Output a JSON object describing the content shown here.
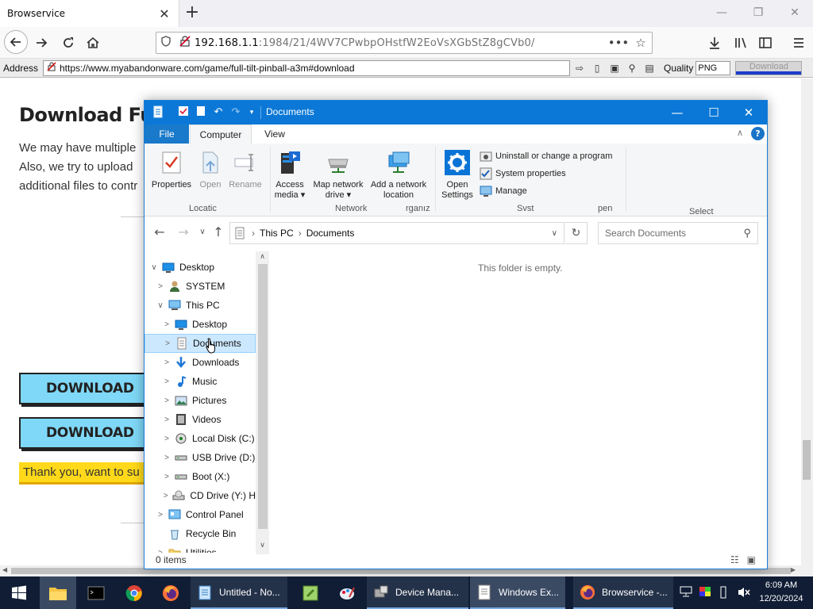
{
  "browser": {
    "tab_title": "Browservice",
    "tab_close": "✕",
    "new_tab": "+",
    "url_host": "192.168.1.1",
    "url_rest": ":1984/21/4WV7CPwbpOHstfW2EoVsXGbStZ8gCVb0/",
    "url_more": "•••",
    "window_controls": [
      "—",
      "❐",
      "✕"
    ]
  },
  "addressbar": {
    "label": "Address",
    "url": "https://www.myabandonware.com/game/full-tilt-pinball-a3m#download",
    "quality_label": "Quality",
    "quality_value": "PNG",
    "download_label": "Download"
  },
  "page": {
    "heading": "Download Full T",
    "para_lines": [
      "We may have multiple",
      "Also, we try to upload",
      "additional files to contr"
    ],
    "download_buttons": [
      "DOWNLOAD",
      "DOWNLOAD"
    ],
    "thanks_text": "Thank you, want to su"
  },
  "explorer": {
    "title": "Documents",
    "tabs": {
      "file": "File",
      "computer": "Computer",
      "view": "View"
    },
    "ribbon": {
      "properties": "Properties",
      "open": "Open",
      "rename": "Rename",
      "access_media": [
        "Access",
        "media ▾"
      ],
      "map_network": [
        "Map network",
        "drive ▾"
      ],
      "add_location": [
        "Add a network",
        "location"
      ],
      "open_settings": [
        "Open",
        "Settings"
      ],
      "uninstall": "Uninstall or change a program",
      "system_properties": "System properties",
      "manage": "Manage",
      "groups": [
        "Locatic",
        "Network",
        "rganız",
        "Svst",
        "pen",
        "Select"
      ]
    },
    "path": [
      "This PC",
      "Documents"
    ],
    "search_placeholder": "Search Documents",
    "tree": [
      {
        "label": "Desktop",
        "level": 0,
        "chev": "∨",
        "icon": "desktop"
      },
      {
        "label": "SYSTEM",
        "level": 1,
        "chev": ">",
        "icon": "user"
      },
      {
        "label": "This PC",
        "level": 1,
        "chev": "∨",
        "icon": "pc"
      },
      {
        "label": "Desktop",
        "level": 2,
        "chev": ">",
        "icon": "desktop"
      },
      {
        "label": "Documents",
        "level": 2,
        "chev": ">",
        "icon": "doc",
        "selected": true
      },
      {
        "label": "Downloads",
        "level": 2,
        "chev": ">",
        "icon": "download"
      },
      {
        "label": "Music",
        "level": 2,
        "chev": ">",
        "icon": "music"
      },
      {
        "label": "Pictures",
        "level": 2,
        "chev": ">",
        "icon": "pictures"
      },
      {
        "label": "Videos",
        "level": 2,
        "chev": ">",
        "icon": "videos"
      },
      {
        "label": "Local Disk (C:)",
        "level": 2,
        "chev": ">",
        "icon": "disk"
      },
      {
        "label": "USB Drive (D:)",
        "level": 2,
        "chev": ">",
        "icon": "usb"
      },
      {
        "label": "Boot (X:)",
        "level": 2,
        "chev": ">",
        "icon": "usb"
      },
      {
        "label": "CD Drive (Y:) H",
        "level": 2,
        "chev": ">",
        "icon": "cd"
      },
      {
        "label": "Control Panel",
        "level": 1,
        "chev": ">",
        "icon": "control"
      },
      {
        "label": "Recycle Bin",
        "level": 1,
        "chev": "",
        "icon": "recycle"
      },
      {
        "label": "Utilities",
        "level": 1,
        "chev": ">",
        "icon": "folder"
      }
    ],
    "empty_message": "This folder is empty.",
    "status": "0 items"
  },
  "taskbar": {
    "apps": [
      {
        "label": "Untitled - No...",
        "state": "open"
      },
      {
        "label": "Device Mana...",
        "state": "open"
      },
      {
        "label": "Windows Ex...",
        "state": "active"
      },
      {
        "label": "Browservice -...",
        "state": "open"
      }
    ],
    "time": "6:09 AM",
    "date": "12/20/2024"
  },
  "colors": {
    "explorer_title": "#0b78d7",
    "download_button": "#7fd8f7",
    "thanks_bar": "#ffd91a",
    "taskbar": "#101d35"
  }
}
